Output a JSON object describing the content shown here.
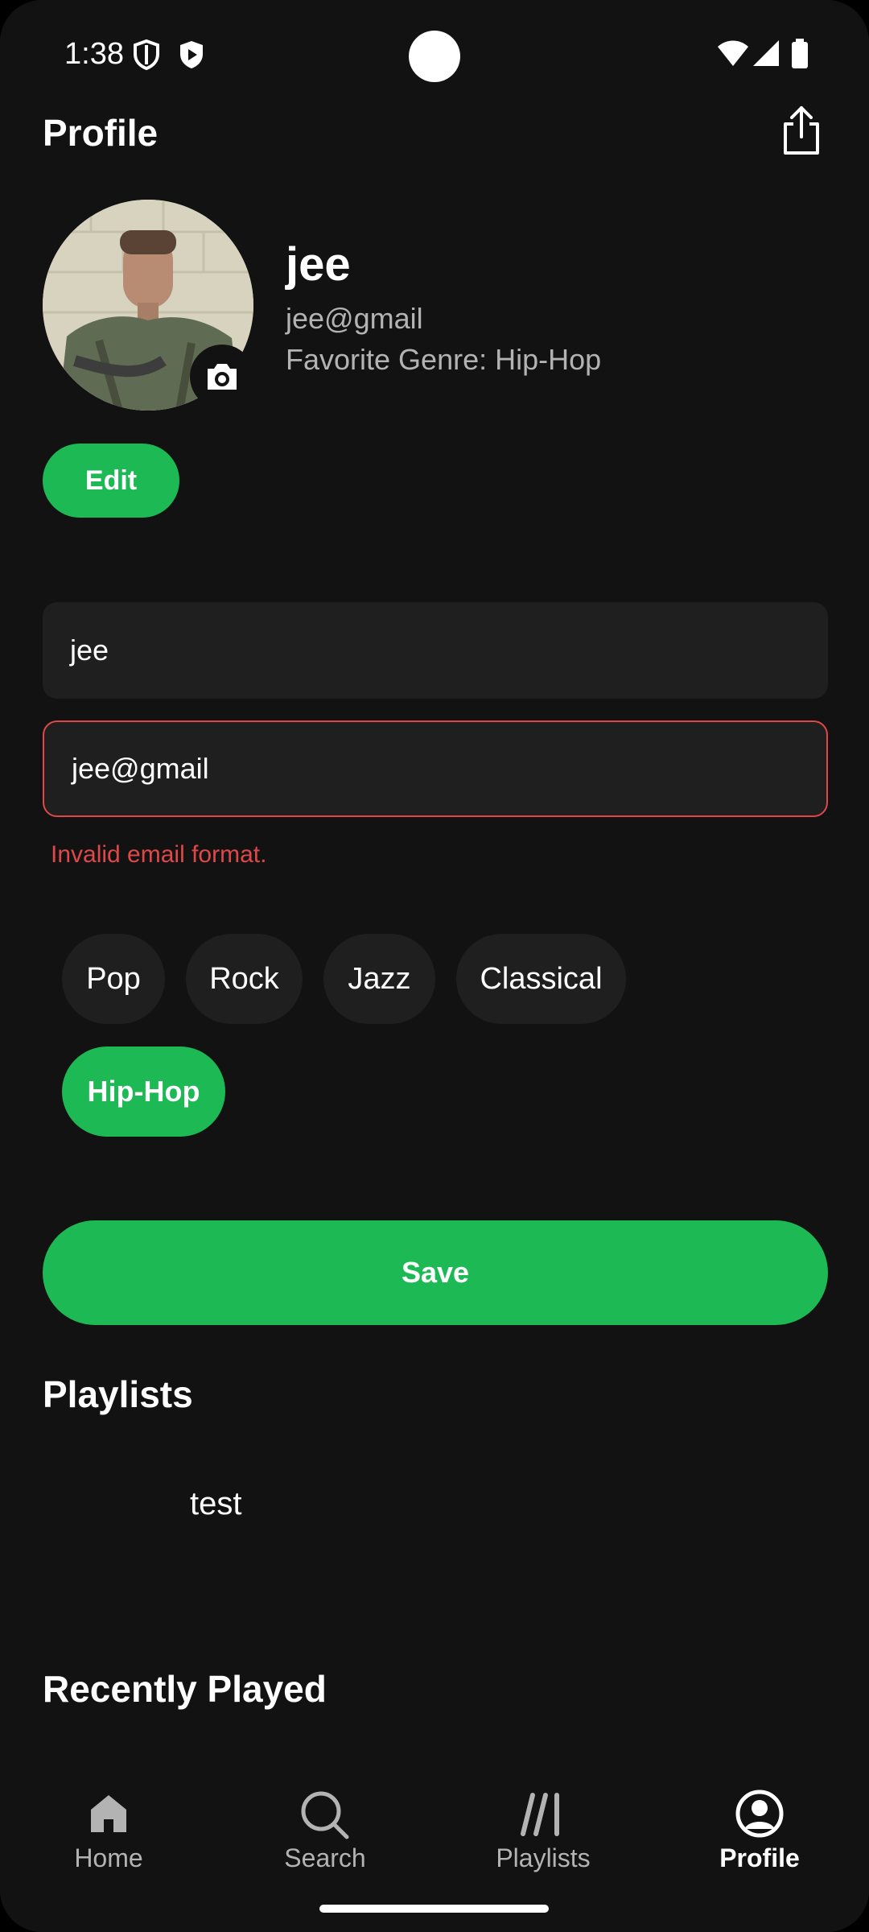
{
  "status_bar": {
    "time": "1:38"
  },
  "header": {
    "title": "Profile"
  },
  "profile": {
    "name": "jee",
    "email": "jee@gmail",
    "favorite_genre": "Favorite Genre: Hip-Hop",
    "edit_label": "Edit"
  },
  "form": {
    "name_value": "jee",
    "email_value": "jee@gmail",
    "email_error": "Invalid email format.",
    "genres": [
      "Pop",
      "Rock",
      "Jazz",
      "Classical",
      "Hip-Hop"
    ],
    "selected_genre": "Hip-Hop",
    "save_label": "Save"
  },
  "playlists": {
    "title": "Playlists",
    "items": [
      {
        "name": "test"
      }
    ]
  },
  "recently_played": {
    "title": "Recently Played"
  },
  "bottom_nav": {
    "items": [
      {
        "label": "Home",
        "icon": "home-icon"
      },
      {
        "label": "Search",
        "icon": "search-icon"
      },
      {
        "label": "Playlists",
        "icon": "library-icon"
      },
      {
        "label": "Profile",
        "icon": "profile-icon"
      }
    ],
    "active": "Profile"
  },
  "colors": {
    "accent": "#1db954",
    "error": "#e04848",
    "background": "#121212",
    "surface": "#1f1f1f"
  }
}
